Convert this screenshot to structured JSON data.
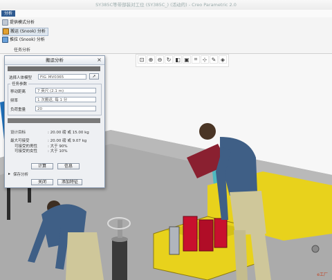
{
  "window": {
    "title": "SY385C等带部装对工位 (SY385C_) (活动的) - Creo Parametric 2.0"
  },
  "ribbon": {
    "active_tab": "分析",
    "commands": [
      {
        "label": "提供模式分析",
        "icon": "analysis-icon"
      },
      {
        "label": "搬运 (Snook) 分析",
        "icon": "carry-analysis-icon",
        "selected": true
      },
      {
        "label": "推拉 (Snook) 分析",
        "icon": "push-pull-icon"
      }
    ],
    "group_label": "任务分析"
  },
  "view_toolbar": [
    {
      "name": "zoom-fit-icon",
      "glyph": "⊡"
    },
    {
      "name": "zoom-in-icon",
      "glyph": "⊕"
    },
    {
      "name": "zoom-out-icon",
      "glyph": "⊖"
    },
    {
      "name": "repaint-icon",
      "glyph": "↻"
    },
    {
      "name": "display-style-icon",
      "glyph": "◧"
    },
    {
      "name": "saved-views-icon",
      "glyph": "▣"
    },
    {
      "name": "datum-display-icon",
      "glyph": "⌗"
    },
    {
      "name": "spin-center-icon",
      "glyph": "⊹"
    },
    {
      "name": "annotation-icon",
      "glyph": "✎"
    },
    {
      "name": "appearance-icon",
      "glyph": "◈"
    }
  ],
  "dialog": {
    "title": "搬运分析",
    "select_label": "选择人体模型",
    "select_value": "FIG_MV0365",
    "task_params_label": "任务参数",
    "carry_distance_label": "移动距离",
    "carry_distance_value": "7 英尺 (2.1 m)",
    "frequency_label": "频率",
    "frequency_value": "1 次搬运, 每 1 分",
    "load_label": "负荷重量",
    "load_value": "20",
    "results": {
      "design_weight_label": "设计目标",
      "design_weight_value": ": 20.00 磅 或 15.00 kg",
      "max_weight_label": "最大可接受",
      "max_weight_value": ": 20.00 磅 或 9.07 kg",
      "male_label": "可接受的男性",
      "male_value": ": 大于 90%",
      "female_label": "可接受的女性",
      "female_value": ": 大于 10%"
    },
    "compute_button": "计算",
    "info_button": "信息",
    "save_analysis_label": "保存分析",
    "close_button": "关闭",
    "add_feature_button": "添加特征"
  },
  "colors": {
    "ribbon_tab": "#2f5b91",
    "fixture_yellow": "#e8d21c",
    "part_red": "#c8102e",
    "worker_shirt": "#3f5f86",
    "worker_pants": "#cfc79a",
    "bench_blue": "#1f6fb8",
    "floor": "#a8a8a8"
  },
  "watermark": "e工厂"
}
